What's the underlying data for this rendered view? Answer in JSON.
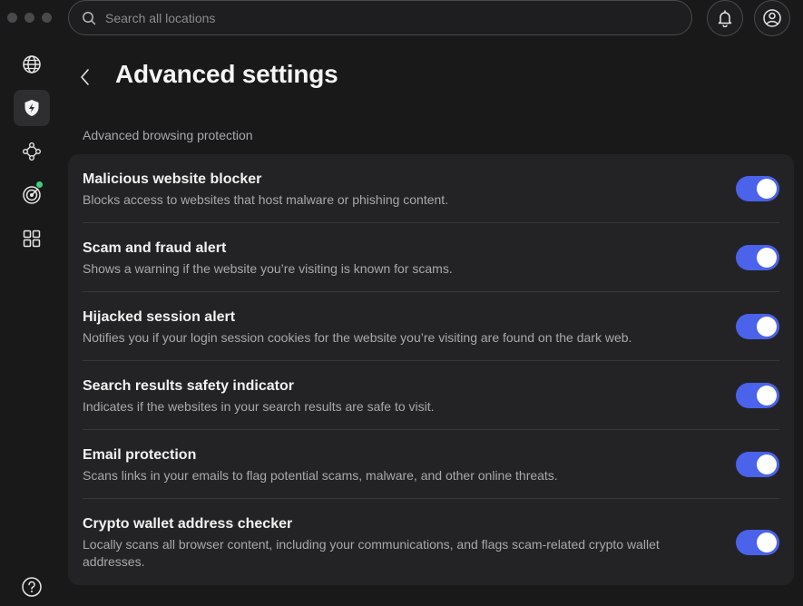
{
  "search": {
    "placeholder": "Search all locations"
  },
  "sidebar": {
    "items": [
      {
        "name": "globe",
        "icon": "globe-icon",
        "active": false
      },
      {
        "name": "threat-protection",
        "icon": "shield-bolt-icon",
        "active": true
      },
      {
        "name": "meshnet",
        "icon": "meshnet-icon",
        "active": false
      },
      {
        "name": "dark-web-monitor",
        "icon": "radar-icon",
        "active": false,
        "status_dot_color": "#3ed07a"
      },
      {
        "name": "apps",
        "icon": "grid-icon",
        "active": false
      }
    ]
  },
  "page": {
    "title": "Advanced settings",
    "section_label": "Advanced browsing protection"
  },
  "settings": [
    {
      "title": "Malicious website blocker",
      "description": "Blocks access to websites that host malware or phishing content.",
      "enabled": true
    },
    {
      "title": "Scam and fraud alert",
      "description": "Shows a warning if the website you’re visiting is known for scams.",
      "enabled": true
    },
    {
      "title": "Hijacked session alert",
      "description": "Notifies you if your login session cookies for the website you’re visiting are found on the dark web.",
      "enabled": true
    },
    {
      "title": "Search results safety indicator",
      "description": "Indicates if the websites in your search results are safe to visit.",
      "enabled": true
    },
    {
      "title": "Email protection",
      "description": "Scans links in your emails to flag potential scams, malware, and other online threats.",
      "enabled": true
    },
    {
      "title": "Crypto wallet address checker",
      "description": "Locally scans all browser content, including your communications, and flags scam-related crypto wallet addresses.",
      "enabled": true
    }
  ],
  "colors": {
    "background": "#19191a",
    "card": "#232325",
    "toggle_on": "#4b62ea",
    "status_green": "#3ed07a"
  }
}
